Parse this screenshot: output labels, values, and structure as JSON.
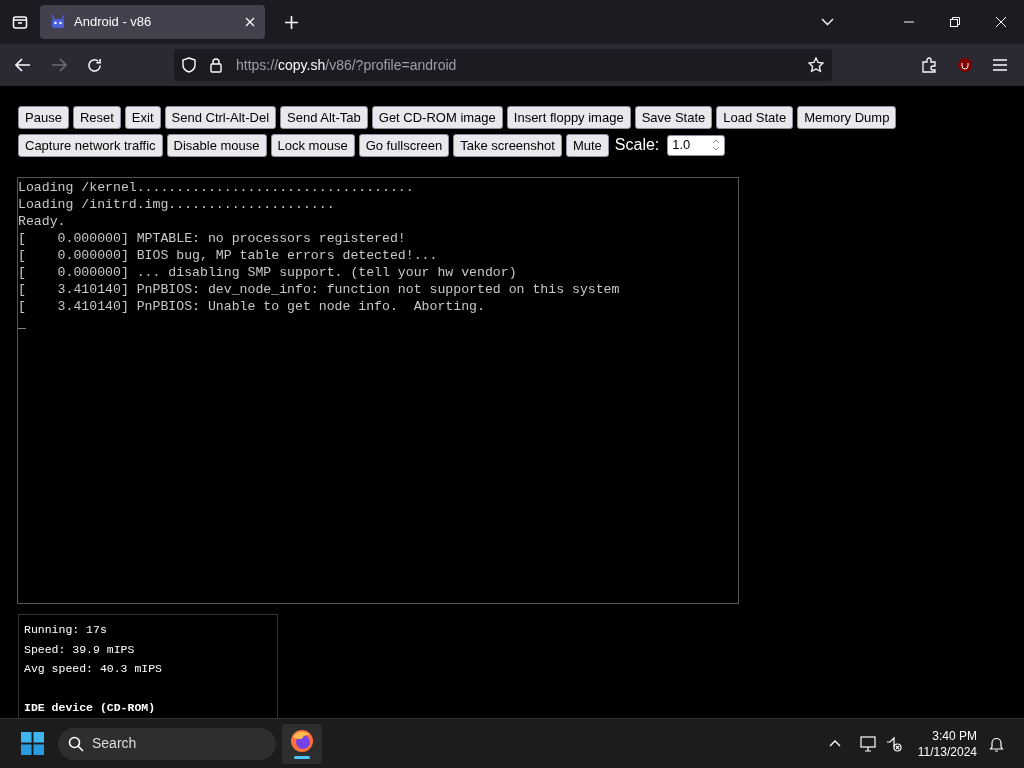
{
  "tab": {
    "title": "Android - v86",
    "selected": true
  },
  "address": {
    "scheme": "https://",
    "host": "copy.sh",
    "path": "/v86/?profile=android"
  },
  "button_rows": [
    [
      "Pause",
      "Reset",
      "Exit",
      "Send Ctrl-Alt-Del",
      "Send Alt-Tab",
      "Get CD-ROM image",
      "Insert floppy image",
      "Save State",
      "Load State",
      "Memory Dump"
    ],
    [
      "Capture network traffic",
      "Disable mouse",
      "Lock mouse",
      "Go fullscreen",
      "Take screenshot",
      "Mute"
    ]
  ],
  "scale": {
    "label": "Scale:",
    "value": "1.0"
  },
  "terminal": {
    "lines": [
      "Loading /kernel...................................",
      "Loading /initrd.img.....................",
      "Ready.",
      "[    0.000000] MPTABLE: no processors registered!",
      "[    0.000000] BIOS bug, MP table errors detected!...",
      "[    0.000000] ... disabling SMP support. (tell your hw vendor)",
      "[    3.410140] PnPBIOS: dev_node_info: function not supported on this system",
      "[    3.410140] PnPBIOS: Unable to get node info.  Aborting.",
      "_"
    ]
  },
  "stats": {
    "lines": [
      "Running: 17s",
      "Speed: 39.9 mIPS",
      "Avg speed: 40.3 mIPS"
    ],
    "heading": "IDE device (CD-ROM)"
  },
  "taskbar": {
    "search": "Search",
    "time": "3:40 PM",
    "date": "11/13/2024"
  }
}
